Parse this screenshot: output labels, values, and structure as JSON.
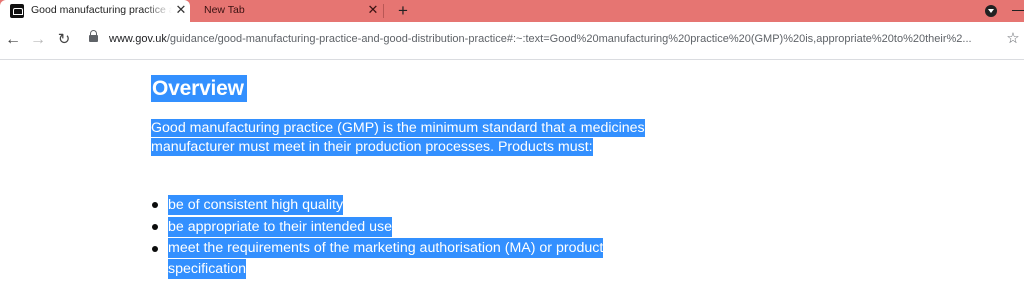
{
  "browser": {
    "tabs": [
      {
        "title": "Good manufacturing practice and good distribution practice - GOV.UK",
        "active": true,
        "favicon": "gov-uk-crown-icon"
      },
      {
        "title": "New Tab",
        "active": false
      }
    ],
    "new_tab_symbol": "+",
    "close_symbol": "✕",
    "tabbar_color": "#e67572",
    "address": {
      "host": "www.gov.uk",
      "path": "/guidance/good-manufacturing-practice-and-good-distribution-practice#:~:text=Good%20manufacturing%20practice%20(GMP)%20is,appropriate%20to%20their%2..."
    },
    "icons": {
      "back": "←",
      "forward": "→",
      "reload": "↻",
      "star": "☆"
    }
  },
  "page": {
    "selection_color": "#3390ff",
    "heading": "Overview",
    "intro": "Good manufacturing practice (GMP) is the minimum standard that a medicines manufacturer must meet in their production processes. Products must:",
    "bullets": [
      "be of consistent high quality",
      "be appropriate to their intended use",
      "meet the requirements of the marketing authorisation (MA) or product specification"
    ]
  }
}
